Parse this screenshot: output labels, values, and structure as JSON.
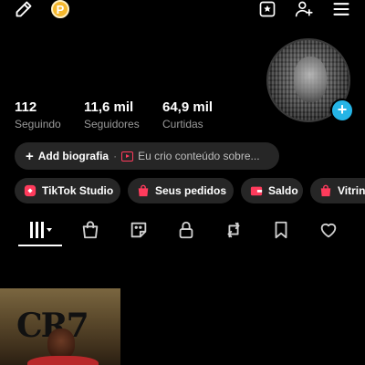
{
  "colors": {
    "background": "#000000",
    "pill_background": "#262626",
    "accent_pink": "#ff3b5c",
    "add_avatar_blue": "#25b4e6",
    "coin": "#f5b82e",
    "secondary_text": "#9a9a9a"
  },
  "topbar": {
    "icons": [
      "pencil-icon",
      "coin-icon",
      "creator-icon",
      "add-friend-icon",
      "menu-icon"
    ],
    "coin_letter": "P"
  },
  "stats": [
    {
      "value": "112",
      "label": "Seguindo"
    },
    {
      "value": "11,6 mil",
      "label": "Seguidores"
    },
    {
      "value": "64,9 mil",
      "label": "Curtidas"
    }
  ],
  "bio": {
    "add_label": "Add biografia",
    "separator": "·",
    "description": "Eu crio conteúdo sobre..."
  },
  "pills": [
    {
      "label": "TikTok Studio",
      "icon": "studio-icon"
    },
    {
      "label": "Seus pedidos",
      "icon": "shopping-bag-icon"
    },
    {
      "label": "Saldo",
      "icon": "wallet-icon"
    },
    {
      "label": "Vitrin",
      "icon": "storefront-icon"
    }
  ],
  "tabs": [
    "videos-grid-icon",
    "shop-icon",
    "sticker-icon",
    "lock-icon",
    "repost-icon",
    "bookmark-icon",
    "heart-icon"
  ],
  "thumbnail": {
    "overlay_text": "CR7"
  }
}
